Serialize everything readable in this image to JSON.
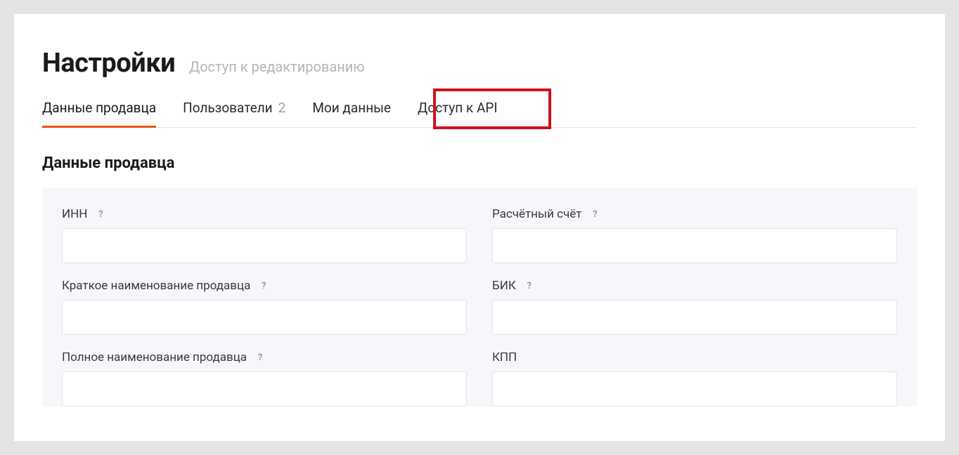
{
  "header": {
    "title": "Настройки",
    "subtitle": "Доступ к редактированию"
  },
  "tabs": [
    {
      "label": "Данные продавца",
      "count": null,
      "active": true
    },
    {
      "label": "Пользователи",
      "count": "2",
      "active": false
    },
    {
      "label": "Мои данные",
      "count": null,
      "active": false
    },
    {
      "label": "Доступ к API",
      "count": null,
      "active": false,
      "highlighted": true
    }
  ],
  "section": {
    "title": "Данные продавца"
  },
  "form": {
    "left": [
      {
        "label": "ИНН",
        "help": "?",
        "value": ""
      },
      {
        "label": "Краткое наименование продавца",
        "help": "?",
        "value": ""
      },
      {
        "label": "Полное наименование продавца",
        "help": "?",
        "value": ""
      }
    ],
    "right": [
      {
        "label": "Расчётный счёт",
        "help": "?",
        "value": ""
      },
      {
        "label": "БИК",
        "help": "?",
        "value": ""
      },
      {
        "label": "КПП",
        "help": null,
        "value": ""
      }
    ]
  }
}
